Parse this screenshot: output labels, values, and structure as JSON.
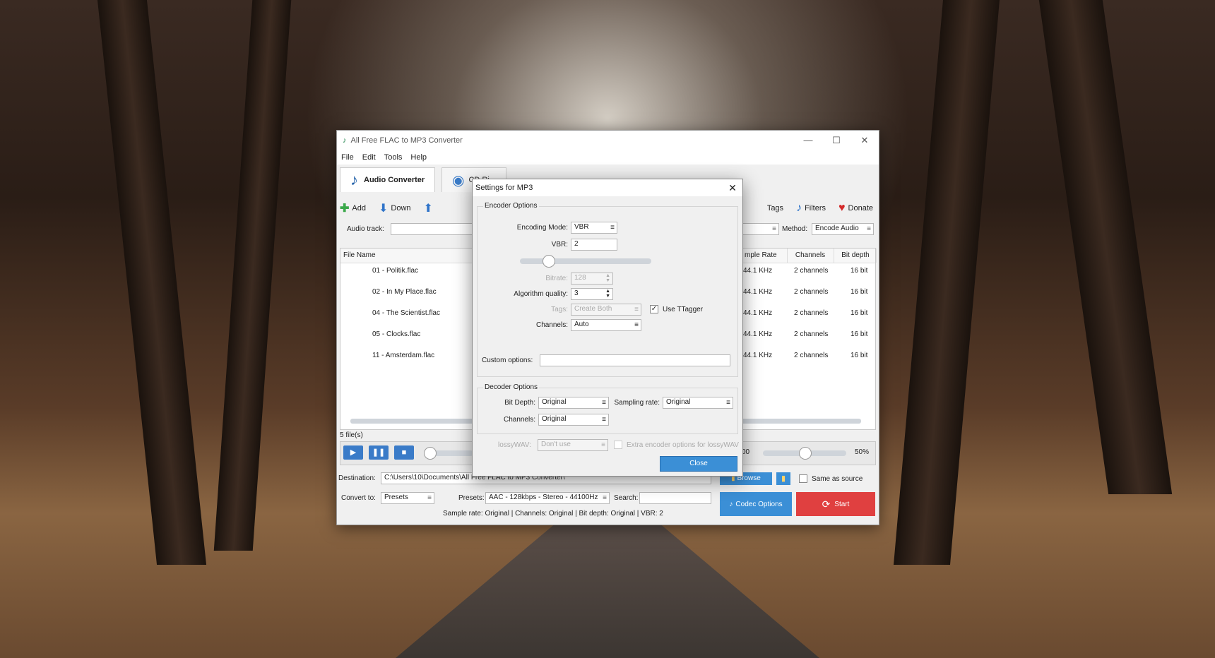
{
  "window": {
    "title": "All Free FLAC to MP3 Converter",
    "controls": [
      "—",
      "☐",
      "✕"
    ]
  },
  "menu": [
    "File",
    "Edit",
    "Tools",
    "Help"
  ],
  "tabs": {
    "audio_converter": "Audio Converter",
    "cd_ripper": "CD Ri..."
  },
  "toolbar": {
    "add": "Add",
    "down": "Down",
    "tags": "Tags",
    "filters": "Filters",
    "donate": "Donate"
  },
  "fields": {
    "audio_track_label": "Audio track:",
    "method_label": "Method:",
    "method_value": "Encode Audio"
  },
  "table": {
    "headers": {
      "file_name": "File Name",
      "sample_rate": "mple Rate",
      "channels": "Channels",
      "bit_depth": "Bit depth"
    },
    "rows": [
      {
        "name": "01 - Politik.flac",
        "rate": "44.1 KHz",
        "channels": "2 channels",
        "depth": "16 bit"
      },
      {
        "name": "02 - In My Place.flac",
        "rate": "44.1 KHz",
        "channels": "2 channels",
        "depth": "16 bit"
      },
      {
        "name": "04 - The Scientist.flac",
        "rate": "44.1 KHz",
        "channels": "2 channels",
        "depth": "16 bit"
      },
      {
        "name": "05 - Clocks.flac",
        "rate": "44.1 KHz",
        "channels": "2 channels",
        "depth": "16 bit"
      },
      {
        "name": "11 - Amsterdam.flac",
        "rate": "44.1 KHz",
        "channels": "2 channels",
        "depth": "16 bit"
      }
    ]
  },
  "status": {
    "file_count": "5 file(s)",
    "volume_left": "00",
    "volume_pct": "50%"
  },
  "bottom": {
    "destination_label": "Destination:",
    "destination_value": "C:\\Users\\10\\Documents\\All Free FLAC to MP3 Converter\\",
    "browse": "Browse",
    "same_as_source": "Same as source",
    "convert_to_label": "Convert to:",
    "convert_to_value": "Presets",
    "presets_label": "Presets:",
    "presets_value": "AAC - 128kbps - Stereo - 44100Hz",
    "search_label": "Search:",
    "summary": "Sample rate: Original | Channels: Original | Bit depth: Original | VBR: 2",
    "codec_options": "Codec Options",
    "start": "Start"
  },
  "dialog": {
    "title": "Settings for  MP3",
    "encoder_group": "Encoder Options",
    "encoding_mode_label": "Encoding Mode:",
    "encoding_mode_value": "VBR",
    "vbr_label": "VBR:",
    "vbr_value": "2",
    "bitrate_label": "Bitrate:",
    "bitrate_value": "128",
    "algo_label": "Algorithm quality:",
    "algo_value": "3",
    "tags_label": "Tags:",
    "tags_value": "Create Both",
    "use_ttagger": "Use TTagger",
    "channels_label": "Channels:",
    "channels_value": "Auto",
    "custom_label": "Custom options:",
    "decoder_group": "Decoder Options",
    "bit_depth_label": "Bit Depth:",
    "bit_depth_value": "Original",
    "sampling_label": "Sampling rate:",
    "sampling_value": "Original",
    "dec_channels_label": "Channels:",
    "dec_channels_value": "Original",
    "lossywav_label": "lossyWAV:",
    "lossywav_value": "Don't use",
    "extra_label": "Extra encoder options for lossyWAV",
    "close": "Close"
  }
}
